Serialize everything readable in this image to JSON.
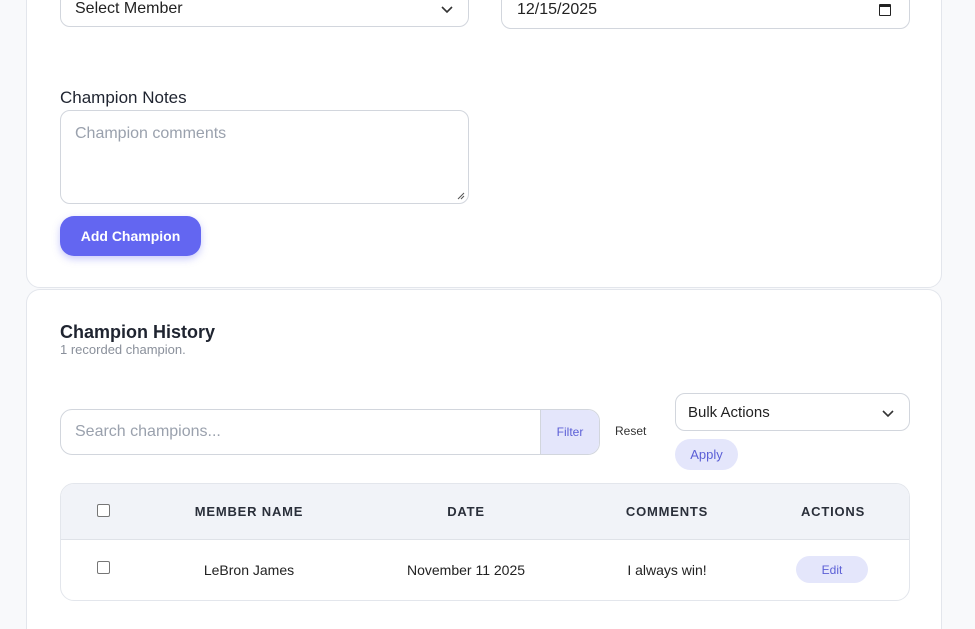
{
  "form": {
    "member_select_value": "Select Member",
    "date_value": "12/15/2025",
    "notes_label": "Champion Notes",
    "notes_placeholder": "Champion comments",
    "add_button": "Add Champion"
  },
  "history": {
    "title": "Champion History",
    "subtitle": "1 recorded champion.",
    "search_placeholder": "Search champions...",
    "filter_button": "Filter",
    "reset_link": "Reset",
    "bulk_actions_value": "Bulk Actions",
    "apply_button": "Apply",
    "table": {
      "columns": [
        "MEMBER NAME",
        "DATE",
        "COMMENTS",
        "ACTIONS"
      ],
      "rows": [
        {
          "member": "LeBron James",
          "date": "November 11 2025",
          "comments": "I always win!",
          "action": "Edit"
        }
      ]
    }
  },
  "colors": {
    "accent": "#6366f1",
    "accent_soft": "#e4e6fb",
    "accent_text": "#5b5fd6"
  }
}
